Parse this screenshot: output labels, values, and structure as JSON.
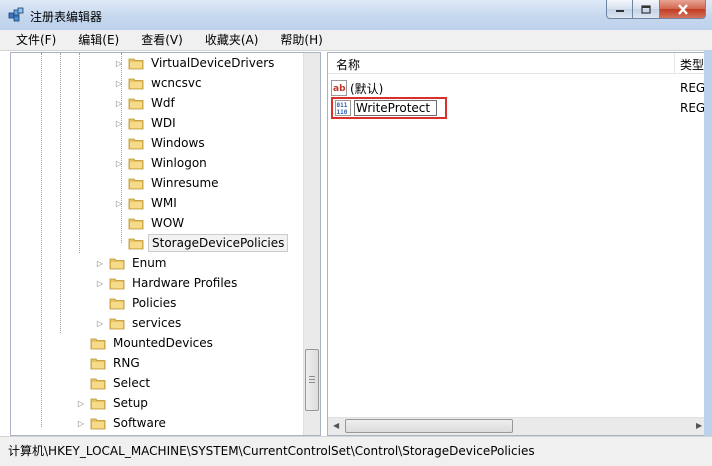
{
  "window": {
    "title": "注册表编辑器",
    "caption_buttons": {
      "minimize": "minimize",
      "maximize": "maximize",
      "close": "close"
    }
  },
  "menu": {
    "items": [
      "文件(F)",
      "编辑(E)",
      "查看(V)",
      "收藏夹(A)",
      "帮助(H)"
    ]
  },
  "tree": {
    "rows": [
      {
        "label": "VirtualDeviceDrivers",
        "expandable": true
      },
      {
        "label": "wcncsvc",
        "expandable": true
      },
      {
        "label": "Wdf",
        "expandable": true
      },
      {
        "label": "WDI",
        "expandable": true
      },
      {
        "label": "Windows",
        "expandable": false
      },
      {
        "label": "Winlogon",
        "expandable": true
      },
      {
        "label": "Winresume",
        "expandable": false
      },
      {
        "label": "WMI",
        "expandable": true
      },
      {
        "label": "WOW",
        "expandable": false
      },
      {
        "label": "StorageDevicePolicies",
        "expandable": false,
        "selected": true
      },
      {
        "label": "Enum",
        "expandable": true
      },
      {
        "label": "Hardware Profiles",
        "expandable": true
      },
      {
        "label": "Policies",
        "expandable": false
      },
      {
        "label": "services",
        "expandable": true
      },
      {
        "label": "MountedDevices",
        "expandable": false
      },
      {
        "label": "RNG",
        "expandable": false
      },
      {
        "label": "Select",
        "expandable": false
      },
      {
        "label": "Setup",
        "expandable": true
      },
      {
        "label": "Software",
        "expandable": true
      }
    ]
  },
  "list": {
    "columns": {
      "name": "名称",
      "type": "类型"
    },
    "rows": [
      {
        "name": "(默认)",
        "type": "REG",
        "icon": "string-value-icon"
      },
      {
        "name": "WriteProtect",
        "type": "REG",
        "icon": "dword-value-icon",
        "editing": true
      }
    ]
  },
  "status": {
    "path": "计算机\\HKEY_LOCAL_MACHINE\\SYSTEM\\CurrentControlSet\\Control\\StorageDevicePolicies"
  },
  "colors": {
    "rename_highlight": "#d9302a",
    "folder": "#e8c260",
    "titlebar": "#c6d8ee"
  }
}
